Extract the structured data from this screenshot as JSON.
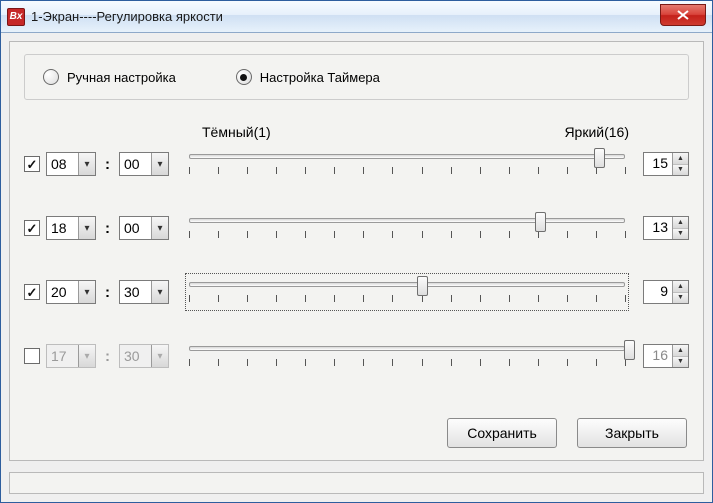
{
  "window": {
    "title": "1-Экран----Регулировка яркости"
  },
  "mode": {
    "manual_label": "Ручная настройка",
    "timer_label": "Настройка Таймера",
    "selected": "timer"
  },
  "labels": {
    "dark": "Тёмный(1)",
    "bright": "Яркий(16)"
  },
  "slider": {
    "min": 1,
    "max": 16,
    "ticks": 16
  },
  "rows": [
    {
      "enabled": true,
      "hour": "08",
      "minute": "00",
      "value": 15,
      "focused": false
    },
    {
      "enabled": true,
      "hour": "18",
      "minute": "00",
      "value": 13,
      "focused": false
    },
    {
      "enabled": true,
      "hour": "20",
      "minute": "30",
      "value": 9,
      "focused": true
    },
    {
      "enabled": false,
      "hour": "17",
      "minute": "30",
      "value": 16,
      "focused": false
    }
  ],
  "buttons": {
    "save": "Сохранить",
    "close": "Закрыть"
  }
}
